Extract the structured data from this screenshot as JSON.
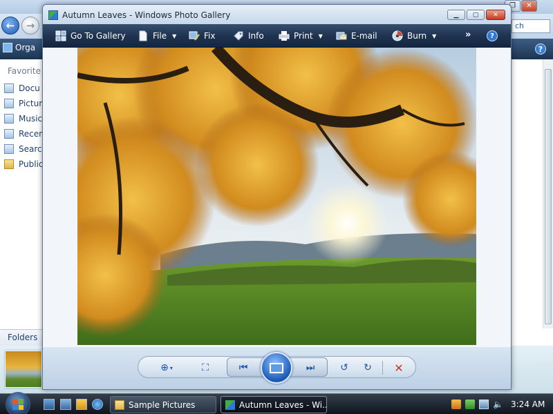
{
  "explorer": {
    "search_text": "ch",
    "toolbar": {
      "organize_label": "Orga"
    },
    "favorites_heading": "Favorite L",
    "favorites": [
      {
        "label": "Docu",
        "icon": "documents-icon"
      },
      {
        "label": "Pictur",
        "icon": "pictures-icon"
      },
      {
        "label": "Music",
        "icon": "music-icon"
      },
      {
        "label": "Recen",
        "icon": "recent-icon"
      },
      {
        "label": "Search",
        "icon": "searches-icon"
      },
      {
        "label": "Public",
        "icon": "public-folder-icon"
      }
    ],
    "folders_label": "Folders"
  },
  "gallery": {
    "title": "Autumn Leaves - Windows Photo Gallery",
    "toolbar": {
      "go_to_gallery": "Go To Gallery",
      "file": "File",
      "fix": "Fix",
      "info": "Info",
      "print": "Print",
      "email": "E-mail",
      "burn": "Burn",
      "more": "»",
      "help": "?"
    },
    "photo_name": "Autumn Leaves"
  },
  "taskbar": {
    "tasks": [
      {
        "label": "Sample Pictures",
        "icon": "folder-icon"
      },
      {
        "label": "Autumn Leaves - Wi...",
        "icon": "photo-gallery-icon"
      }
    ],
    "clock": "3:24 AM"
  },
  "colors": {
    "toolbar_dark": "#1f3451",
    "accent_blue": "#1f56a8",
    "close_red": "#c8391d",
    "taskbar": "#0e151d"
  }
}
